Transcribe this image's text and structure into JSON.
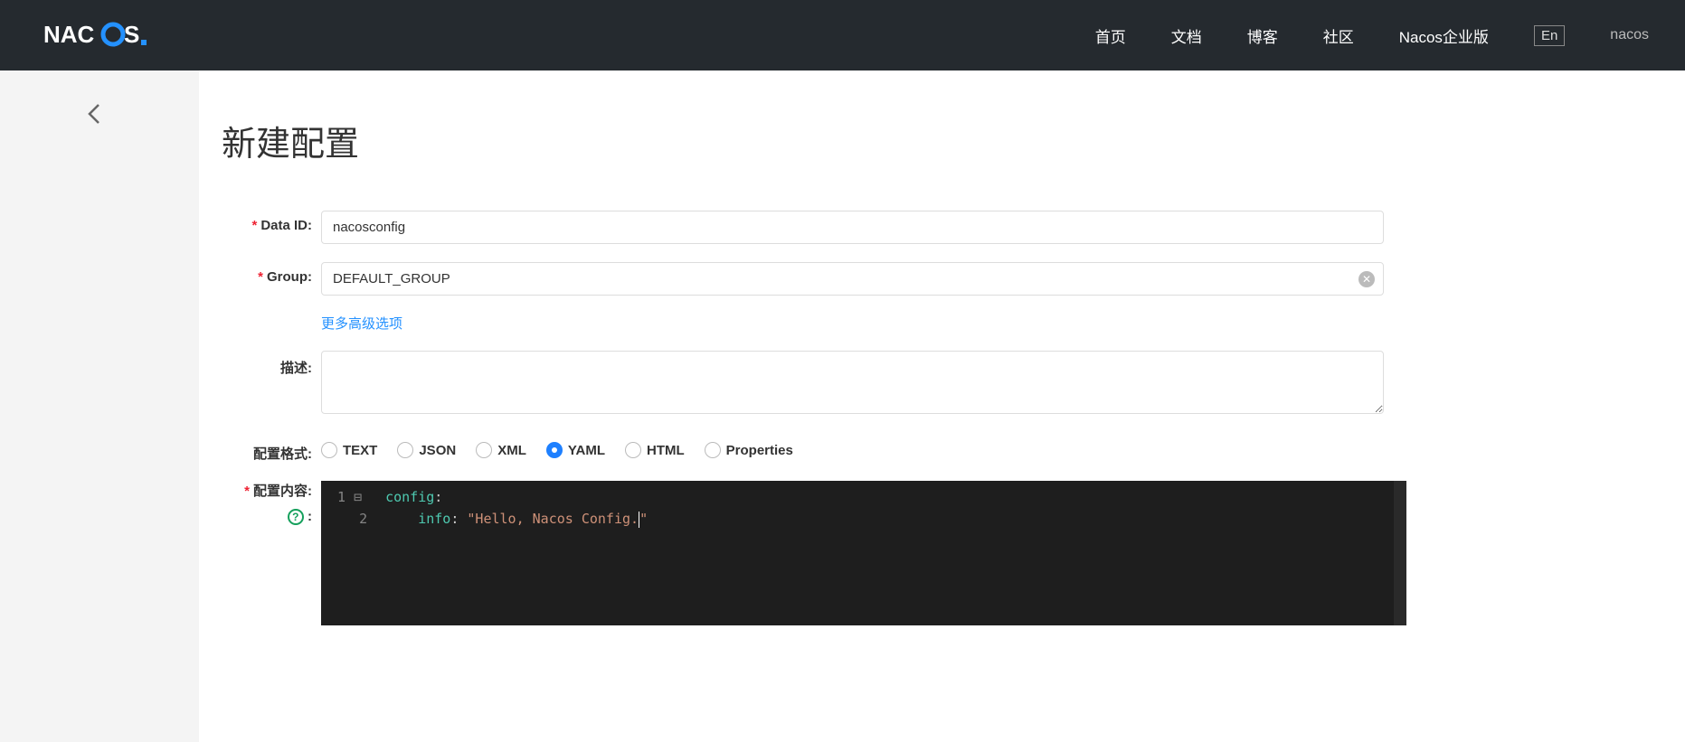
{
  "header": {
    "logo": "NACOS.",
    "nav": [
      {
        "label": "首页"
      },
      {
        "label": "文档"
      },
      {
        "label": "博客"
      },
      {
        "label": "社区"
      },
      {
        "label": "Nacos企业版"
      }
    ],
    "lang": "En",
    "user": "nacos"
  },
  "page": {
    "title": "新建配置"
  },
  "form": {
    "dataid": {
      "label": "Data ID:",
      "value": "nacosconfig"
    },
    "group": {
      "label": "Group:",
      "value": "DEFAULT_GROUP"
    },
    "adv": {
      "label": "更多高级选项"
    },
    "desc": {
      "label": "描述:",
      "value": ""
    },
    "format": {
      "label": "配置格式:",
      "options": [
        "TEXT",
        "JSON",
        "XML",
        "YAML",
        "HTML",
        "Properties"
      ],
      "selected": "YAML"
    },
    "content": {
      "label": "配置内容:",
      "lines": [
        {
          "n": "1",
          "text": "config:"
        },
        {
          "n": "2",
          "text": "    info: \"Hello, Nacos Config.\""
        }
      ]
    }
  }
}
